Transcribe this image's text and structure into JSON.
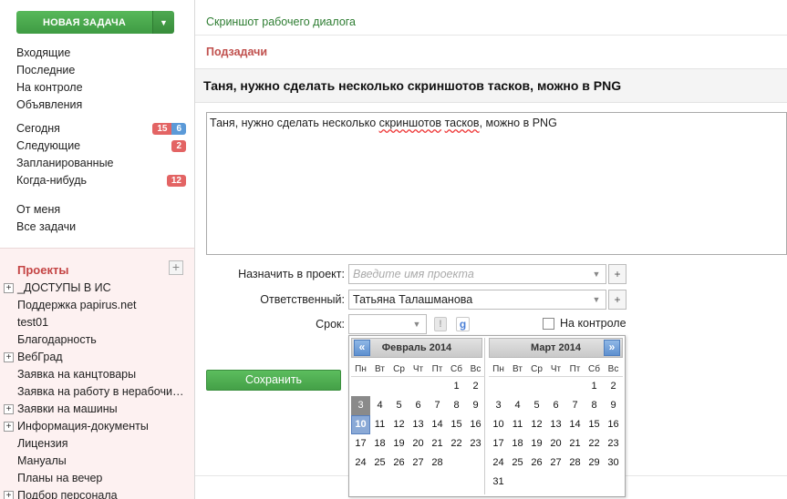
{
  "sidebar": {
    "new_task_label": "НОВАЯ ЗАДАЧА",
    "groups": [
      [
        "Входящие",
        "Последние",
        "На контроле",
        "Объявления"
      ],
      [
        "Сегодня",
        "Следующие",
        "Запланированные",
        "Когда-нибудь"
      ],
      [
        "От меня",
        "Все задачи"
      ]
    ],
    "badges": {
      "today_red": "15",
      "today_blue": "6",
      "next": "2",
      "someday": "12"
    },
    "projects_title": "Проекты",
    "projects": [
      {
        "label": "_ДОСТУПЫ В ИС",
        "expandable": true
      },
      {
        "label": "Поддержка papirus.net",
        "expandable": false
      },
      {
        "label": "test01",
        "expandable": false
      },
      {
        "label": "Благодарность",
        "expandable": false
      },
      {
        "label": "ВебГрад",
        "expandable": true
      },
      {
        "label": "Заявка на канцтовары",
        "expandable": false
      },
      {
        "label": "Заявка на работу в нерабочи…",
        "expandable": false
      },
      {
        "label": "Заявки на машины",
        "expandable": true
      },
      {
        "label": "Информация-документы",
        "expandable": true
      },
      {
        "label": "Лицензия",
        "expandable": false
      },
      {
        "label": "Мануалы",
        "expandable": false
      },
      {
        "label": "Планы на вечер",
        "expandable": false
      },
      {
        "label": "Подбор персонала",
        "expandable": true
      }
    ]
  },
  "main": {
    "breadcrumb": "Скриншот рабочего диалога",
    "subtasks_label": "Подзадачи",
    "task_title": "Таня, нужно сделать несколько скриншотов тасков, можно в PNG",
    "description": {
      "part1": "Таня, нужно сделать несколько ",
      "word1": "скриншотов",
      "space": " ",
      "word2": "тасков",
      "part2": ", можно в PNG"
    },
    "form": {
      "project_label": "Назначить в проект:",
      "project_placeholder": "Введите имя проекта",
      "assignee_label": "Ответственный:",
      "assignee_value": "Татьяна Талашманова",
      "deadline_label": "Срок:",
      "deadline_value": "",
      "priority_icon_glyph": "!",
      "google_icon_glyph": "g",
      "control_label": "На контроле",
      "save_label": "Сохранить"
    }
  },
  "calendar": {
    "weekdays": [
      "Пн",
      "Вт",
      "Ср",
      "Чт",
      "Пт",
      "Сб",
      "Вс"
    ],
    "prev_glyph": "«",
    "next_glyph": "»",
    "months": [
      {
        "title": "Февраль 2014",
        "first_weekday": 5,
        "days": 28,
        "past_days": [
          3
        ],
        "today": 10
      },
      {
        "title": "Март 2014",
        "first_weekday": 5,
        "days": 31,
        "past_days": [],
        "today": null
      }
    ]
  },
  "icons": {
    "dropdown": "chevron-down-icon",
    "add": "plus-icon",
    "expand": "plus-box-icon"
  },
  "colors": {
    "accent_green": "#44a047",
    "link_green": "#2e7d32",
    "heading_red": "#c0504d",
    "badge_red": "#e36464",
    "badge_blue": "#5b9ad8"
  }
}
